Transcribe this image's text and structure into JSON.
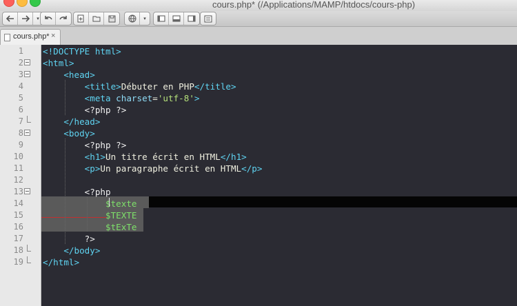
{
  "window": {
    "title": "cours.php* (/Applications/MAMP/htdocs/cours-php)"
  },
  "toolbar": {
    "icons": [
      "back-arrow-icon",
      "forward-arrow-icon",
      "dropdown-icon",
      "undo-icon",
      "redo-icon",
      "new-file-icon",
      "open-folder-icon",
      "save-icon",
      "preview-globe-icon",
      "dropdown-icon",
      "split-left-icon",
      "split-bottom-icon",
      "split-right-icon",
      "settings-icon"
    ]
  },
  "tab": {
    "label": "cours.php*",
    "close": "×"
  },
  "lines": [
    {
      "n": "1",
      "parts": [
        {
          "c": "tag",
          "t": "<!DOCTYPE html>"
        }
      ]
    },
    {
      "n": "2",
      "parts": [
        {
          "c": "tag",
          "t": "<html>"
        }
      ]
    },
    {
      "n": "3",
      "parts": [
        {
          "c": "txt",
          "t": "    "
        },
        {
          "c": "tag",
          "t": "<head>"
        }
      ]
    },
    {
      "n": "4",
      "parts": [
        {
          "c": "txt",
          "t": "        "
        },
        {
          "c": "tag",
          "t": "<title>"
        },
        {
          "c": "txt",
          "t": "Débuter en PHP"
        },
        {
          "c": "tag",
          "t": "</title>"
        }
      ]
    },
    {
      "n": "5",
      "parts": [
        {
          "c": "txt",
          "t": "        "
        },
        {
          "c": "tag",
          "t": "<meta "
        },
        {
          "c": "attr",
          "t": "charset"
        },
        {
          "c": "txt",
          "t": "="
        },
        {
          "c": "str",
          "t": "'utf-8'"
        },
        {
          "c": "tag",
          "t": ">"
        }
      ]
    },
    {
      "n": "6",
      "parts": [
        {
          "c": "txt",
          "t": "        "
        },
        {
          "c": "php",
          "t": "<?php ?>"
        }
      ]
    },
    {
      "n": "7",
      "parts": [
        {
          "c": "txt",
          "t": "    "
        },
        {
          "c": "tag",
          "t": "</head>"
        }
      ]
    },
    {
      "n": "8",
      "parts": [
        {
          "c": "txt",
          "t": "    "
        },
        {
          "c": "tag",
          "t": "<body>"
        }
      ]
    },
    {
      "n": "9",
      "parts": [
        {
          "c": "txt",
          "t": "        "
        },
        {
          "c": "php",
          "t": "<?php ?>"
        }
      ]
    },
    {
      "n": "10",
      "parts": [
        {
          "c": "txt",
          "t": "        "
        },
        {
          "c": "tag",
          "t": "<h1>"
        },
        {
          "c": "txt",
          "t": "Un titre écrit en HTML"
        },
        {
          "c": "tag",
          "t": "</h1>"
        }
      ]
    },
    {
      "n": "11",
      "parts": [
        {
          "c": "txt",
          "t": "        "
        },
        {
          "c": "tag",
          "t": "<p>"
        },
        {
          "c": "txt",
          "t": "Un paragraphe écrit en HTML"
        },
        {
          "c": "tag",
          "t": "</p>"
        }
      ]
    },
    {
      "n": "12",
      "parts": []
    },
    {
      "n": "13",
      "parts": [
        {
          "c": "txt",
          "t": "        "
        },
        {
          "c": "php",
          "t": "<?php"
        }
      ]
    },
    {
      "n": "14",
      "parts": [
        {
          "c": "txt",
          "t": "            "
        },
        {
          "c": "var",
          "t": "$texte"
        }
      ]
    },
    {
      "n": "15",
      "parts": [
        {
          "c": "txt",
          "t": "            "
        },
        {
          "c": "var",
          "t": "$TEXTE"
        }
      ]
    },
    {
      "n": "16",
      "parts": [
        {
          "c": "txt",
          "t": "            "
        },
        {
          "c": "var",
          "t": "$tExTe"
        }
      ]
    },
    {
      "n": "17",
      "parts": [
        {
          "c": "txt",
          "t": "        "
        },
        {
          "c": "php",
          "t": "?>"
        }
      ]
    },
    {
      "n": "18",
      "parts": [
        {
          "c": "txt",
          "t": "    "
        },
        {
          "c": "tag",
          "t": "</body>"
        }
      ]
    },
    {
      "n": "19",
      "parts": [
        {
          "c": "tag",
          "t": "</html>"
        }
      ]
    }
  ],
  "folds": {
    "open": [
      "2",
      "3",
      "8",
      "13"
    ],
    "end": [
      "7",
      "18",
      "19"
    ]
  }
}
